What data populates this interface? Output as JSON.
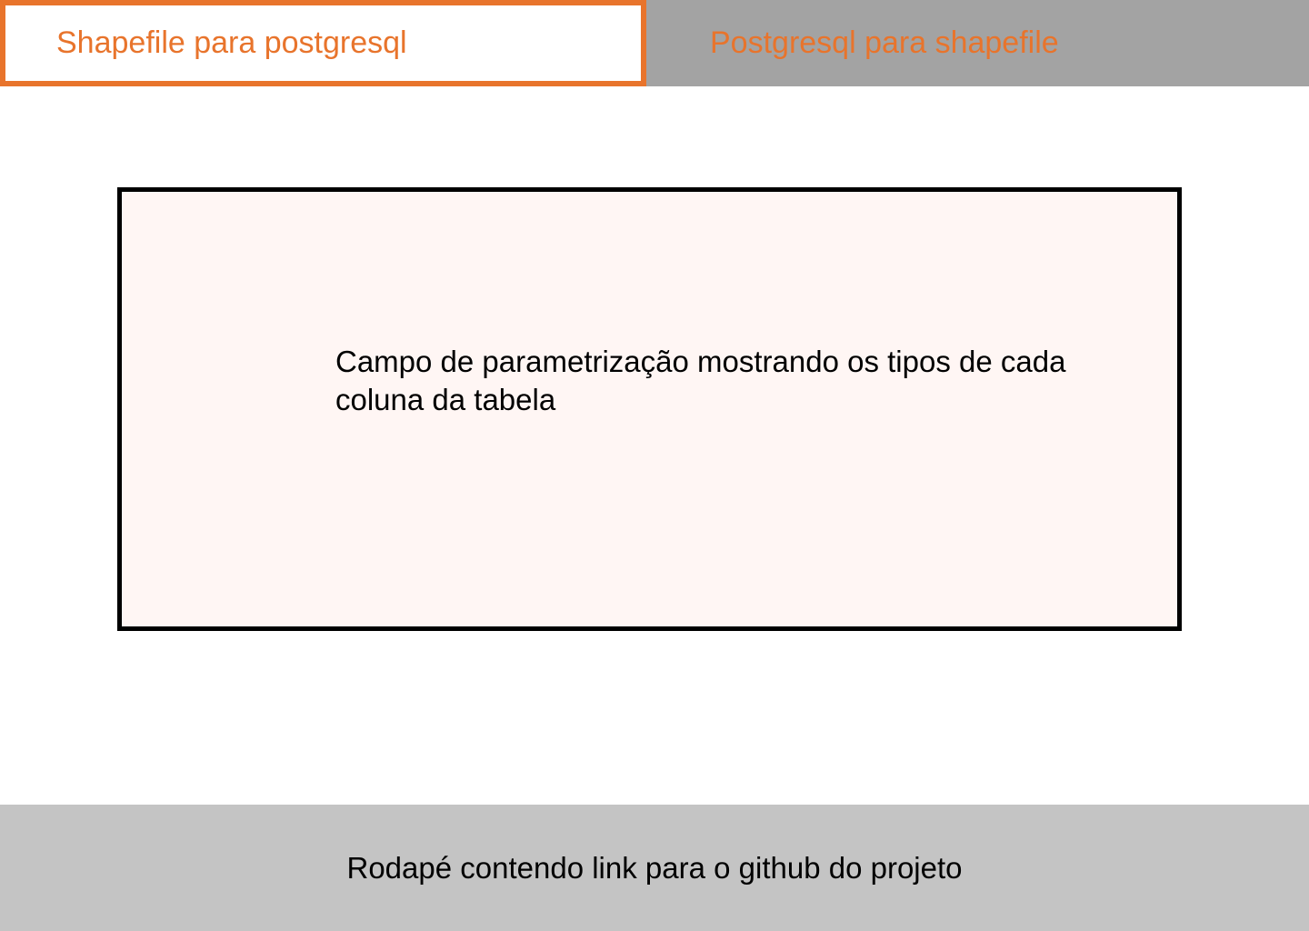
{
  "tabs": [
    {
      "label": "Shapefile para postgresql",
      "active": true
    },
    {
      "label": "Postgresql para shapefile",
      "active": false
    }
  ],
  "main": {
    "panel_text": "Campo de parametrização  mostrando os tipos de cada coluna da tabela"
  },
  "footer": {
    "text": "Rodapé contendo link para o github do projeto"
  },
  "colors": {
    "accent": "#e8742c",
    "inactive_tab_bg": "#a3a3a3",
    "panel_bg": "#fff6f4",
    "footer_bg": "#c4c4c4"
  }
}
